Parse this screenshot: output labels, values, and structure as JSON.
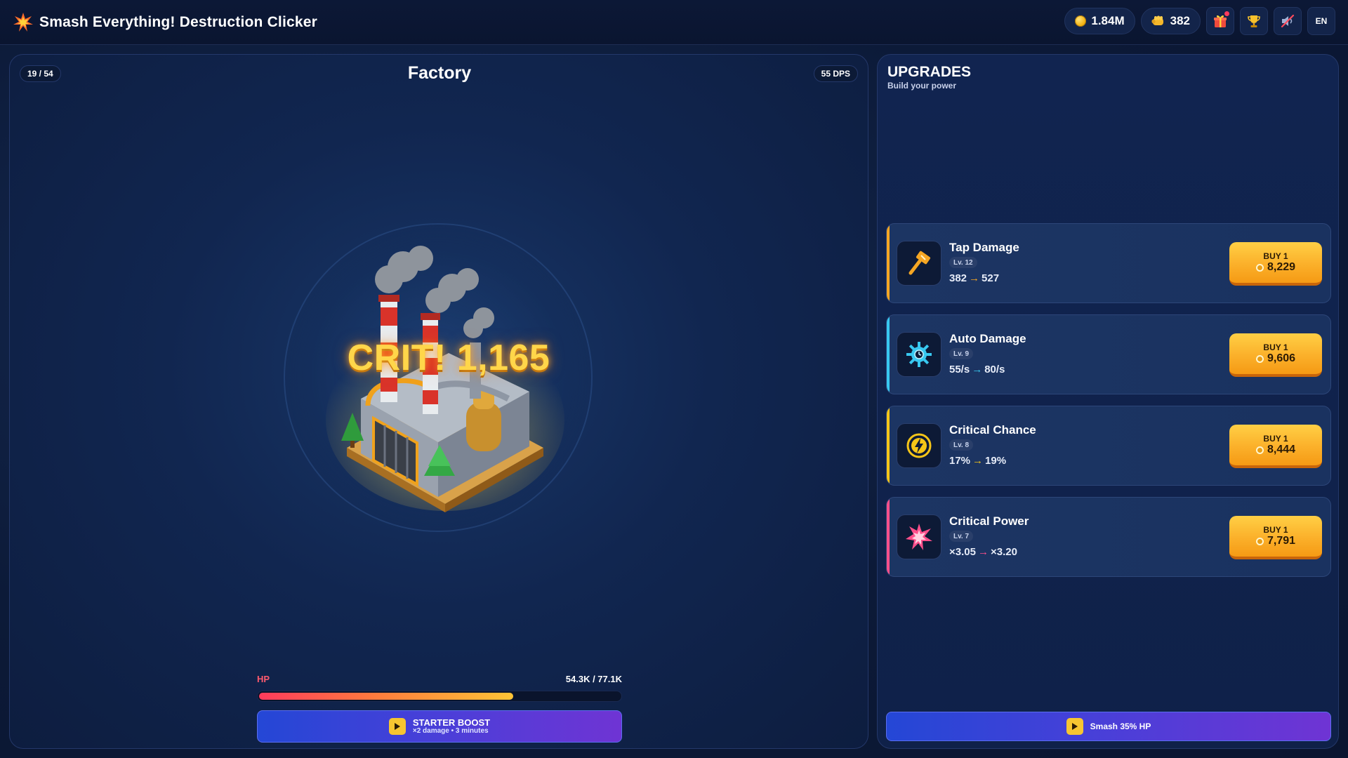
{
  "app": {
    "title": "Smash Everything! Destruction Clicker",
    "coins": "1.84M",
    "tap_power": "382",
    "language": "EN"
  },
  "arena": {
    "stage": "19 / 54",
    "area_name": "Factory",
    "dps": "55 DPS",
    "crit_popup": "CRIT! 1,165",
    "hp_label": "HP",
    "hp_text": "54.3K / 77.1K",
    "hp_fraction": 0.704,
    "boost_title": "STARTER BOOST",
    "boost_sub": "×2 damage • 3 minutes"
  },
  "upgrades": {
    "title": "UPGRADES",
    "subtitle": "Build your power",
    "items": [
      {
        "name": "Tap Damage",
        "level": "Lv. 12",
        "from": "382",
        "to": "527",
        "buy": "BUY 1",
        "price": "8,229",
        "icon": "hammer-icon",
        "accent": "#f5a623"
      },
      {
        "name": "Auto Damage",
        "level": "Lv. 9",
        "from": "55/s",
        "to": "80/s",
        "buy": "BUY 1",
        "price": "9,606",
        "icon": "gear-icon",
        "accent": "#38c8f0"
      },
      {
        "name": "Critical Chance",
        "level": "Lv. 8",
        "from": "17%",
        "to": "19%",
        "buy": "BUY 1",
        "price": "8,444",
        "icon": "lightning-icon",
        "accent": "#f5c518"
      },
      {
        "name": "Critical Power",
        "level": "Lv. 7",
        "from": "×3.05",
        "to": "×3.20",
        "buy": "BUY 1",
        "price": "7,791",
        "icon": "burst-icon",
        "accent": "#ff4f8b"
      }
    ],
    "smash_label": "Smash 35% HP"
  }
}
